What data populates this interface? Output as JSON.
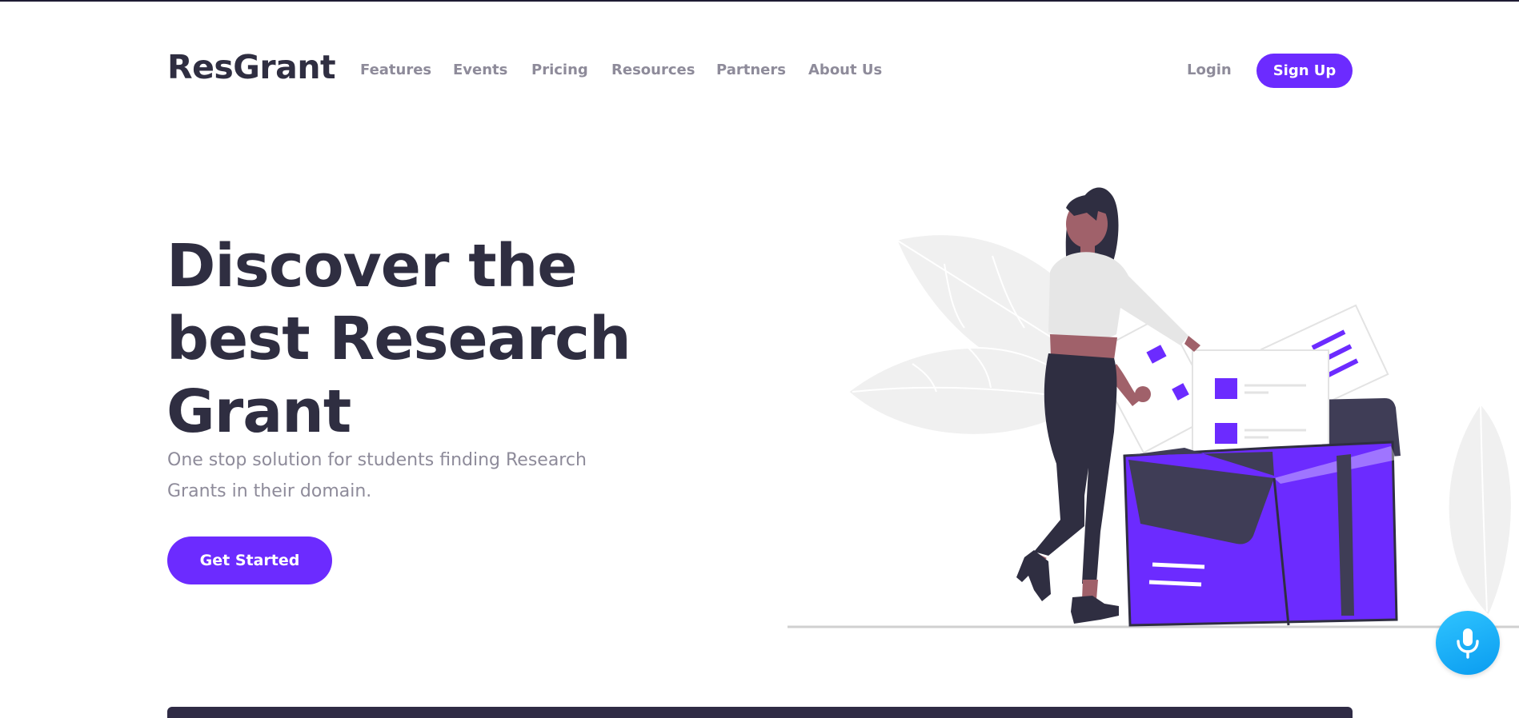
{
  "brand": {
    "name": "ResGrant"
  },
  "nav": {
    "items": [
      {
        "label": "Features"
      },
      {
        "label": "Events"
      },
      {
        "label": "Pricing"
      },
      {
        "label": "Resources"
      },
      {
        "label": "Partners"
      },
      {
        "label": "About Us"
      }
    ]
  },
  "auth": {
    "login_label": "Login",
    "signup_label": "Sign Up"
  },
  "hero": {
    "title_line1": "Discover the",
    "title_line2": "best Research",
    "title_line3": "Grant",
    "subtitle": "One stop solution for students finding Research Grants in their domain.",
    "cta_label": "Get Started"
  },
  "colors": {
    "accent": "#6c2bff",
    "text_dark": "#2f2e41",
    "text_muted": "#8e8b9a",
    "mic_blue": "#1ab3f7"
  },
  "icons": {
    "voice_button": "microphone-icon"
  }
}
